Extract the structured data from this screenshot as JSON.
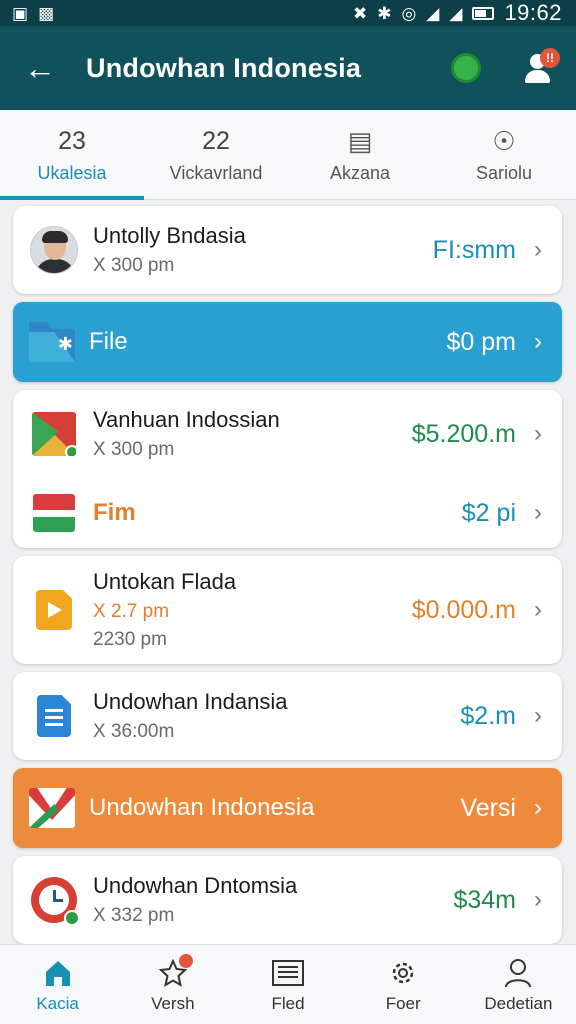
{
  "status_bar": {
    "time": "19:62"
  },
  "app_bar": {
    "title": "Undowhan Indonesia",
    "badge": "!!"
  },
  "tabs": [
    {
      "count": "23",
      "label": "Ukalesia",
      "active": true
    },
    {
      "count": "22",
      "label": "Vickavrland",
      "active": false
    },
    {
      "glyph": "document-icon",
      "label": "Akzana",
      "active": false
    },
    {
      "glyph": "info-icon",
      "label": "Sariolu",
      "active": false
    }
  ],
  "items": {
    "row1": {
      "title": "Untolly Bndasia",
      "subtitle": "X 300 pm",
      "amount": "FI:smm"
    },
    "banner_file": {
      "title": "File",
      "amount": "$0 pm"
    },
    "row2": {
      "title": "Vanhuan Indossian",
      "subtitle": "X 300 pm",
      "amount": "$5.200.m"
    },
    "row3": {
      "title": "Fim",
      "amount": "$2 pi"
    },
    "row4": {
      "title": "Untokan Flada",
      "subtitle": "X 2.7 pm",
      "subtitle2": "2230 pm",
      "amount": "$0.000.m"
    },
    "row5": {
      "title": "Undowhan Indansia",
      "subtitle": "X 36:00m",
      "amount": "$2.m"
    },
    "banner_orange": {
      "title": "Undowhan Indonesia",
      "amount": "Versi"
    },
    "row6": {
      "title": "Undowhan Dntomsia",
      "subtitle": "X 332 pm",
      "amount": "$34m"
    }
  },
  "colors": {
    "primary": "#11515c",
    "accent": "#1a8fb5",
    "banner_blue": "#2a9fd2",
    "banner_orange": "#ee8a3c",
    "amount_teal": "#1a8fb5",
    "amount_green": "#1f8a4c",
    "amount_orange": "#e0812e"
  },
  "bottom_nav": [
    {
      "label": "Kacia",
      "icon": "home-icon",
      "active": true
    },
    {
      "label": "Versh",
      "icon": "star-icon",
      "active": false
    },
    {
      "label": "Fled",
      "icon": "newspaper-icon",
      "active": false
    },
    {
      "label": "Foer",
      "icon": "gear-icon",
      "active": false
    },
    {
      "label": "Dedetian",
      "icon": "person-icon",
      "active": false
    }
  ]
}
